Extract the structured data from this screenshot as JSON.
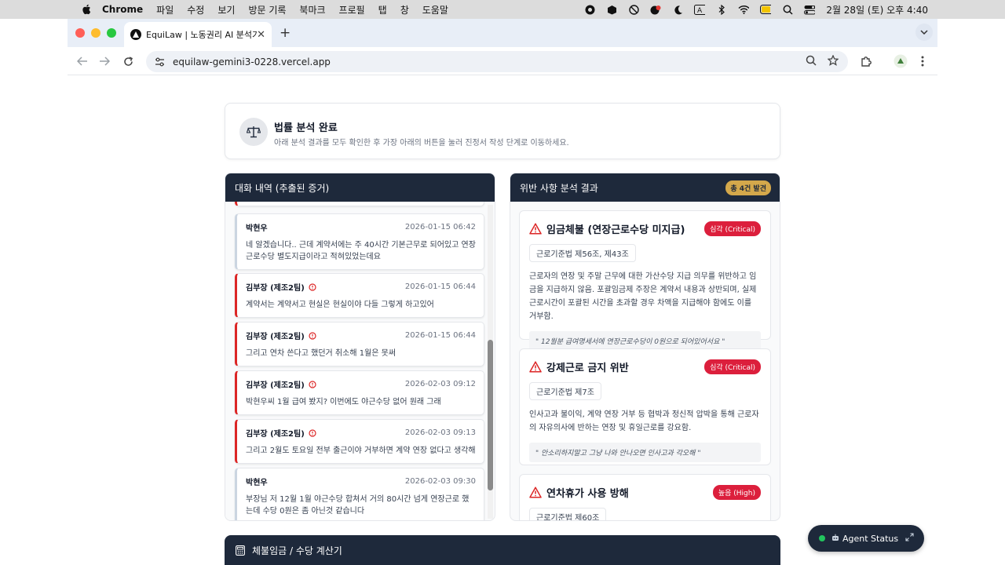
{
  "menubar": {
    "app": "Chrome",
    "items": [
      "파일",
      "수정",
      "보기",
      "방문 기록",
      "북마크",
      "프로필",
      "탭",
      "창",
      "도움말"
    ],
    "clock": "2월 28일 (토) 오후 4:40"
  },
  "browser": {
    "tab_title": "EquiLaw | 노동권리 AI 분석기",
    "url": "equilaw-gemini3-0228.vercel.app"
  },
  "status": {
    "title": "법률 분석 완료",
    "description": "아래 분석 결과를 모두 확인한 후 가장 아래의 버튼을 눌러 진정서 작성 단계로 이동하세요."
  },
  "chat_panel": {
    "title": "대화 내역 (추출된 증거)",
    "messages": [
      {
        "sender": "박현우",
        "role": "user",
        "flagged": false,
        "time": "2026-01-15 06:42",
        "text": "네 알겠습니다.. 근데 계약서에는 주 40시간 기본근무로 되어있고 연장근로수당 별도지급이라고 적혀있었는데요"
      },
      {
        "sender": "김부장 (제조2팀)",
        "role": "boss",
        "flagged": true,
        "time": "2026-01-15 06:44",
        "text": "계약서는 계약서고 현실은 현실이야 다들 그렇게 하고있어"
      },
      {
        "sender": "김부장 (제조2팀)",
        "role": "boss",
        "flagged": true,
        "time": "2026-01-15 06:44",
        "text": "그리고 연차 쓴다고 했던거 취소해 1월은 못써"
      },
      {
        "sender": "김부장 (제조2팀)",
        "role": "boss",
        "flagged": true,
        "time": "2026-02-03 09:12",
        "text": "박현우씨 1월 급여 봤지? 이번에도 야근수당 없어 원래 그래"
      },
      {
        "sender": "김부장 (제조2팀)",
        "role": "boss",
        "flagged": true,
        "time": "2026-02-03 09:13",
        "text": "그리고 2월도 토요일 전부 출근이야 거부하면 계약 연장 없다고 생각해"
      },
      {
        "sender": "박현우",
        "role": "user",
        "flagged": false,
        "time": "2026-02-03 09:30",
        "text": "부장님 저 12월 1월 야근수당 합쳐서 거의 80시간 넘게 연장근로 했는데 수당 0원은 좀 아닌것 같습니다"
      }
    ]
  },
  "violation_panel": {
    "title": "위반 사항 분석 결과",
    "count_badge": "총 4건 발견",
    "items": [
      {
        "title": "임금체불 (연장근로수당 미지급)",
        "severity": "심각 (Critical)",
        "law": "근로기준법 제56조, 제43조",
        "description": "근로자의 연장 및 주말 근무에 대한 가산수당 지급 의무를 위반하고 임금을 지급하지 않음. 포괄임금제 주장은 계약서 내용과 상반되며, 실제 근로시간이 포괄된 시간을 초과할 경우 차액을 지급해야 함에도 이를 거부함.",
        "quote": "\" 12월분 급여명세서에 연장근로수당이 0원으로 되어있어서요 \""
      },
      {
        "title": "강제근로 금지 위반",
        "severity": "심각 (Critical)",
        "law": "근로기준법 제7조",
        "description": "인사고과 불이익, 계약 연장 거부 등 협박과 정신적 압박을 통해 근로자의 자유의사에 반하는 연장 및 휴일근로를 강요함.",
        "quote": "\" 안소리하지말고 그냥 나와 안나오면 인사고과 각오해 \""
      },
      {
        "title": "연차휴가 사용 방해",
        "severity": "높음 (High)",
        "law": "근로기준법 제60조",
        "description": "",
        "quote": ""
      }
    ]
  },
  "calculator": {
    "title": "체불임금 / 수당 계산기"
  },
  "agent": {
    "label": "Agent Status"
  },
  "colors": {
    "navy": "#1e293b",
    "critical": "#dc1f3c",
    "gold": "#d4a84b",
    "online": "#22c55e"
  }
}
